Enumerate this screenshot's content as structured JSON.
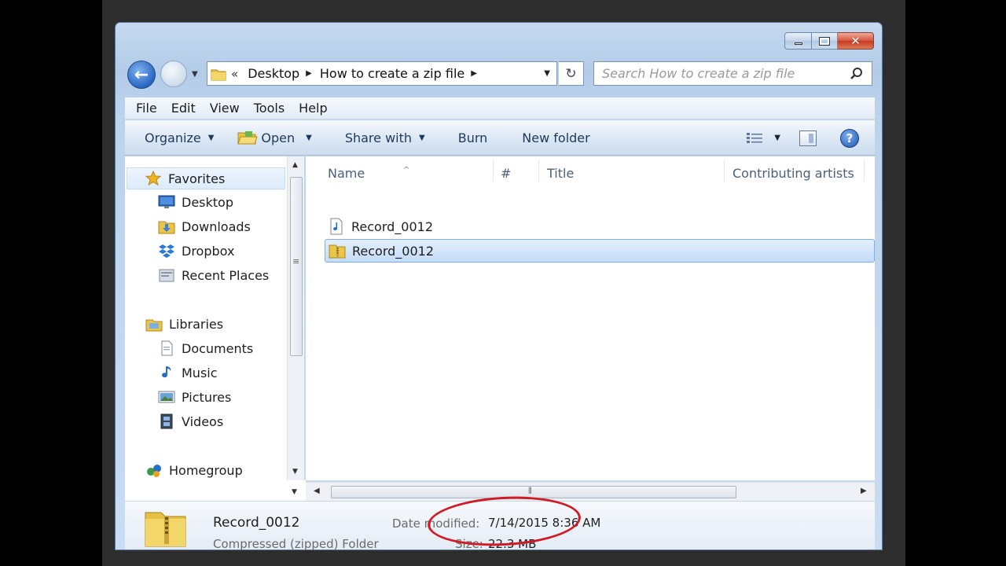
{
  "window": {
    "controls": {
      "minimize": "minimize",
      "maximize": "maximize",
      "close": "close"
    }
  },
  "address": {
    "overflow": "«",
    "segments": [
      "Desktop",
      "How to create a zip file"
    ]
  },
  "search": {
    "placeholder": "Search How to create a zip file"
  },
  "menu": [
    "File",
    "Edit",
    "View",
    "Tools",
    "Help"
  ],
  "toolbar": {
    "organize": "Organize",
    "open": "Open",
    "share_with": "Share with",
    "burn": "Burn",
    "new_folder": "New folder"
  },
  "navigation": {
    "favorites": {
      "label": "Favorites",
      "items": [
        "Desktop",
        "Downloads",
        "Dropbox",
        "Recent Places"
      ]
    },
    "libraries": {
      "label": "Libraries",
      "items": [
        "Documents",
        "Music",
        "Pictures",
        "Videos"
      ]
    },
    "homegroup": "Homegroup"
  },
  "columns": [
    "Name",
    "#",
    "Title",
    "Contributing artists"
  ],
  "files": [
    {
      "name": "Record_0012",
      "icon": "audio-file-icon",
      "selected": false
    },
    {
      "name": "Record_0012",
      "icon": "zip-folder-icon",
      "selected": true
    }
  ],
  "details": {
    "name": "Record_0012",
    "type": "Compressed (zipped) Folder",
    "date_label": "Date modified:",
    "date_value": "7/14/2015 8:36 AM",
    "size_label": "Size:",
    "size_value": "22.3 MB"
  },
  "colors": {
    "annotation": "#d01a24",
    "selection": "#c4dcf7",
    "accent": "#2a66c4"
  }
}
